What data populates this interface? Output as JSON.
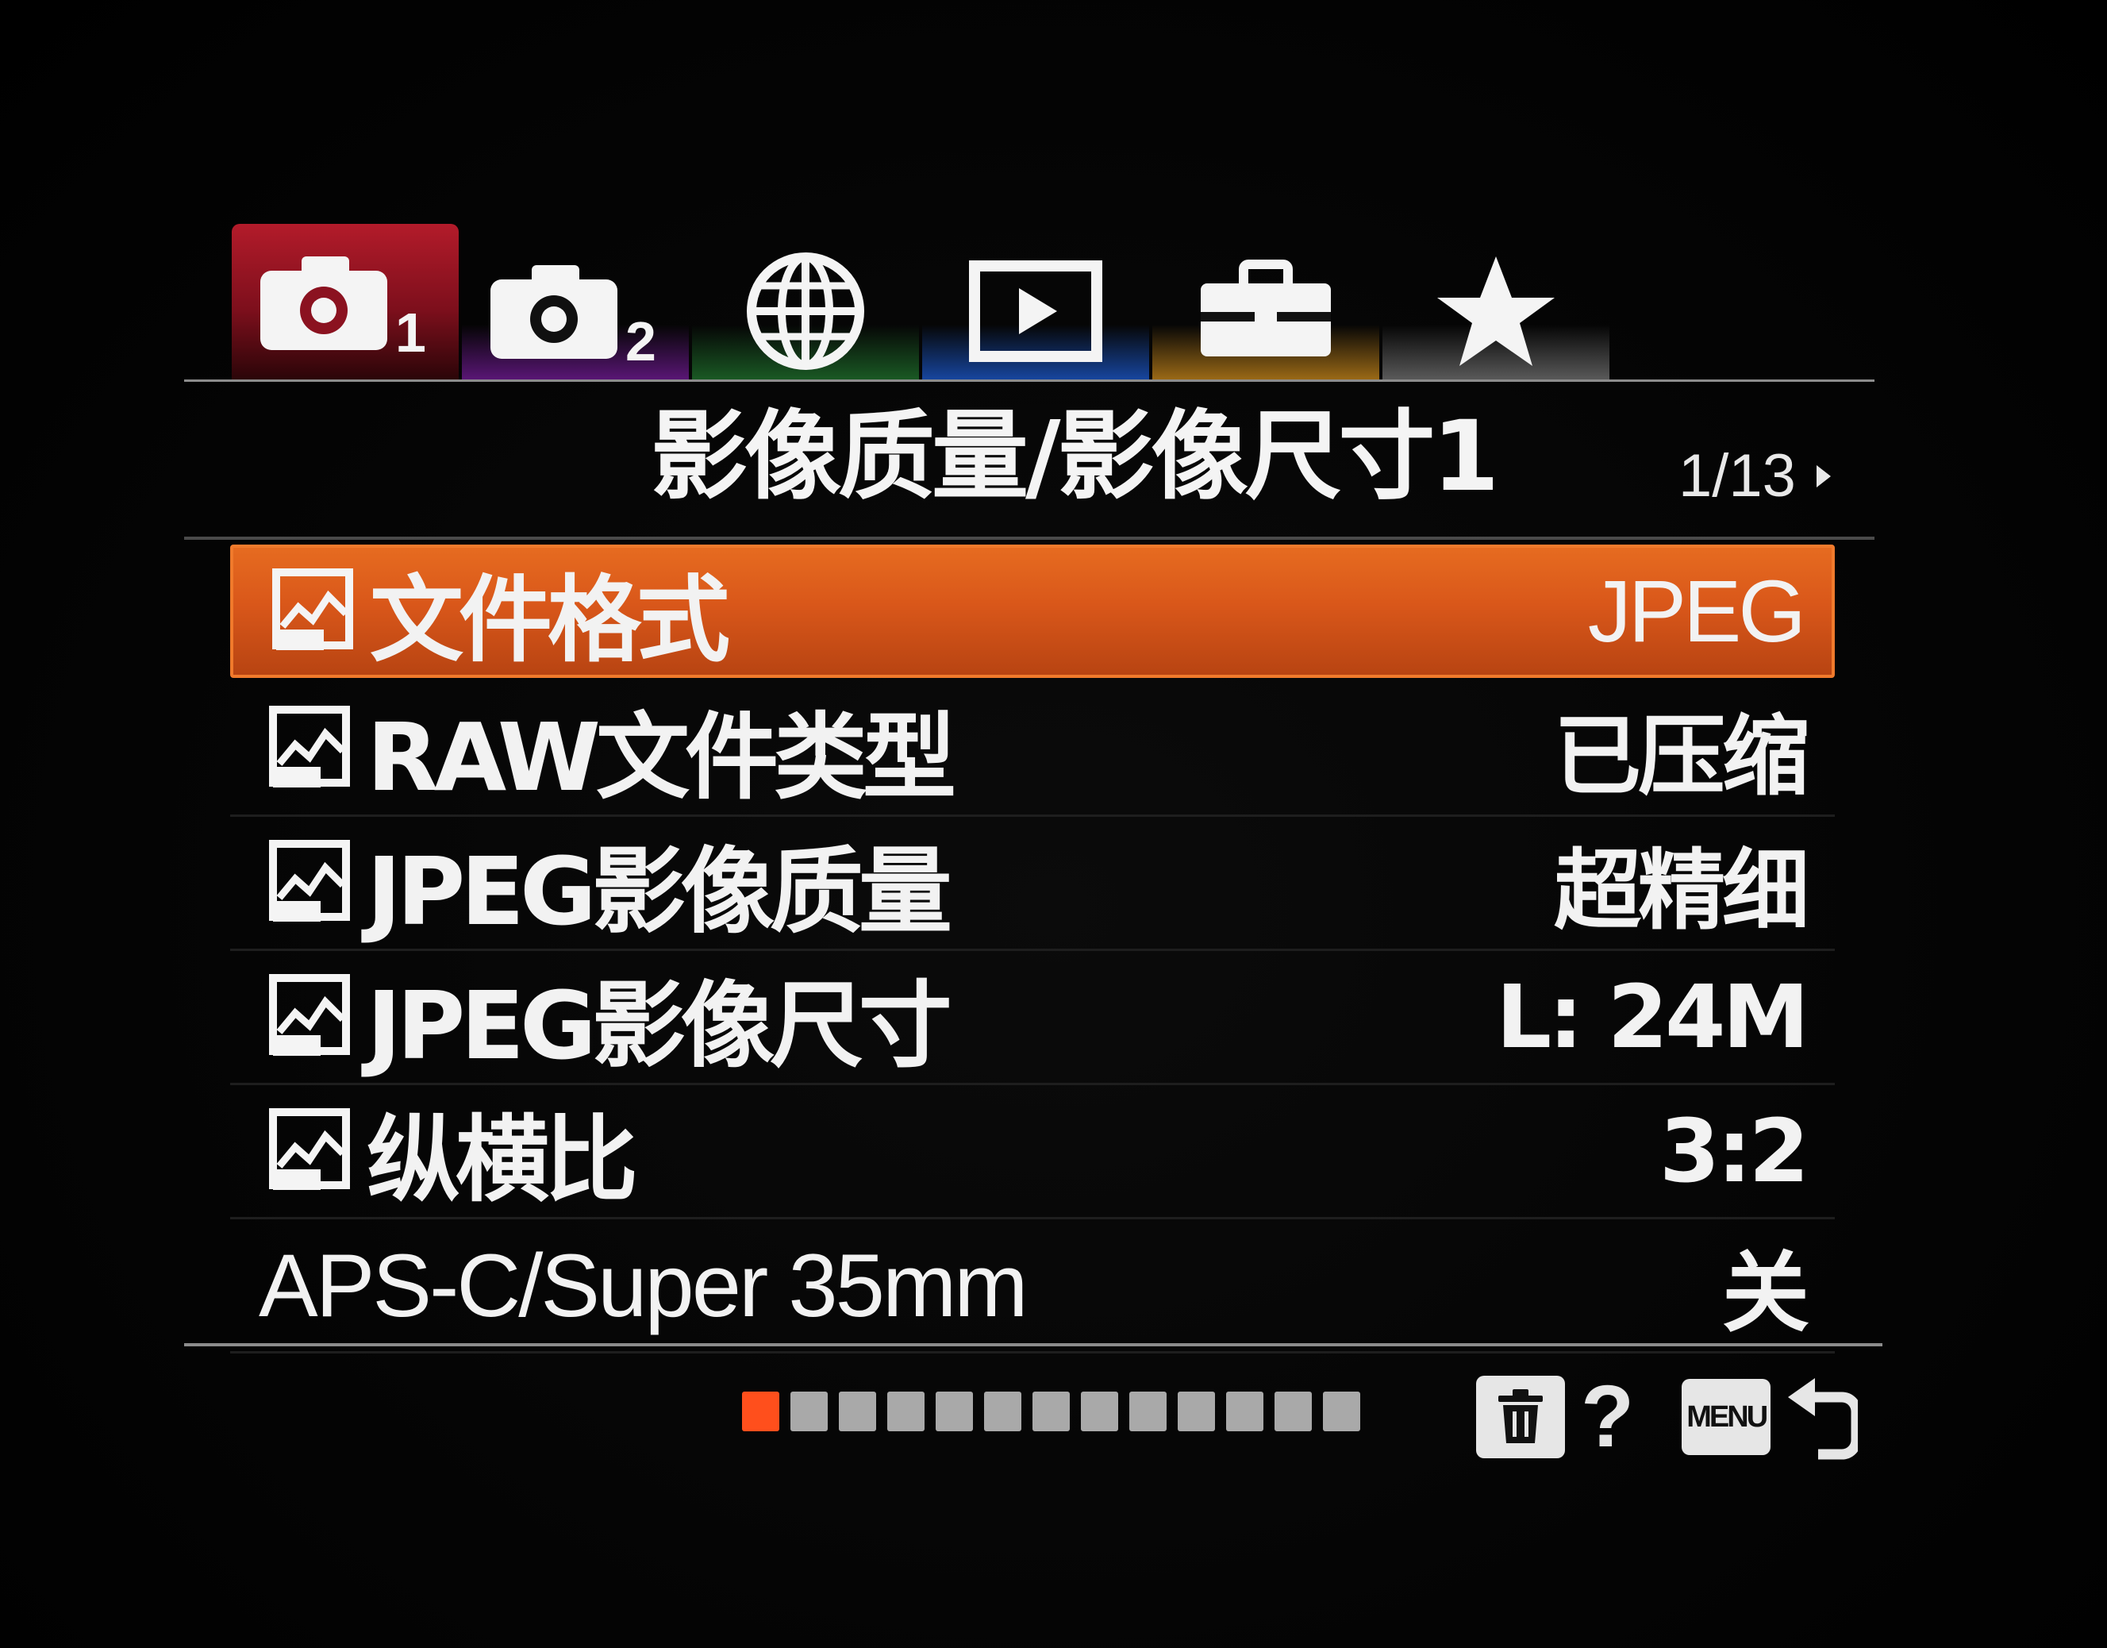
{
  "tabs": [
    {
      "name": "camera1",
      "badge": "1",
      "color": "#a01b2a",
      "active": true
    },
    {
      "name": "camera2",
      "badge": "2",
      "color": "#6a1a8a",
      "active": false
    },
    {
      "name": "network",
      "color": "#1f6b2a",
      "active": false
    },
    {
      "name": "playback",
      "color": "#1a4fb0",
      "active": false
    },
    {
      "name": "setup",
      "color": "#b07a1a",
      "active": false
    },
    {
      "name": "my-menu",
      "color": "#7a7a7a",
      "active": false
    }
  ],
  "header": {
    "title": "影像质量/影像尺寸1",
    "page_indicator": "1/13"
  },
  "menu": {
    "items": [
      {
        "label": "文件格式",
        "value": "JPEG",
        "has_icon": true,
        "selected": true
      },
      {
        "label": "RAW文件类型",
        "value": "已压缩",
        "has_icon": true,
        "selected": false
      },
      {
        "label": "JPEG影像质量",
        "value": "超精细",
        "has_icon": true,
        "selected": false
      },
      {
        "label": "JPEG影像尺寸",
        "value": "L: 24M",
        "has_icon": true,
        "selected": false
      },
      {
        "label": "纵横比",
        "value": "3:2",
        "has_icon": true,
        "selected": false
      },
      {
        "label": "APS-C/Super 35mm",
        "value": "关",
        "has_icon": false,
        "selected": false
      }
    ]
  },
  "footer": {
    "total_pages": 13,
    "current_page": 1,
    "menu_key_label": "MENU",
    "help_glyph": "?",
    "icons": [
      "trash-icon",
      "help-icon",
      "menu-key-icon",
      "back-icon"
    ]
  },
  "colors": {
    "selected_row": "#e0621d",
    "current_page_dot": "#ff4f1c",
    "page_dot": "#a9a9a9"
  }
}
